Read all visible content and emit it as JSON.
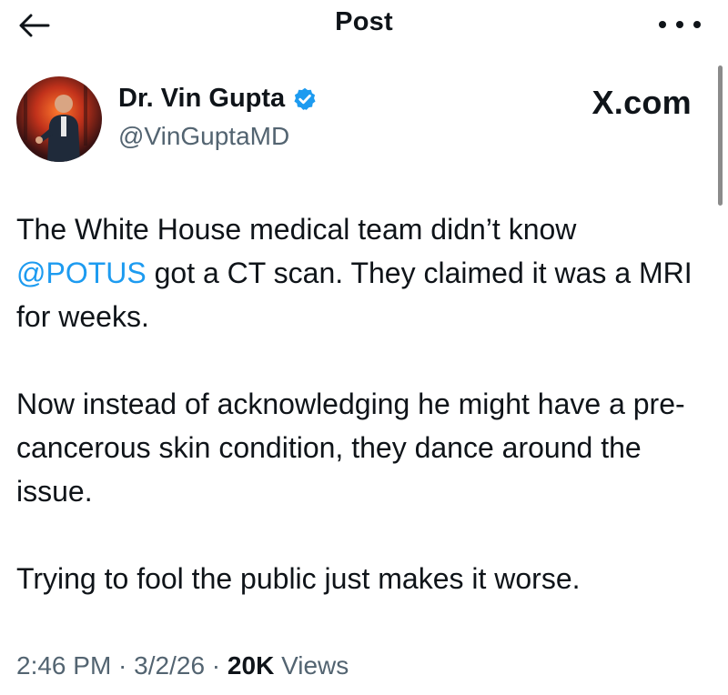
{
  "header": {
    "title": "Post",
    "back_icon": "arrow-left-icon",
    "more_icon": "more-horizontal-icon"
  },
  "author": {
    "name": "Dr. Vin Gupta",
    "handle": "@VinGuptaMD",
    "verified_color": "#1d9bf0",
    "source": "X.com"
  },
  "post": {
    "line1_prefix": "The White House medical team didn’t know",
    "mention": "@POTUS",
    "line2_suffix": " got a CT scan. They claimed it was a MRI for weeks.",
    "paragraph2": "Now instead of acknowledging he might have a pre-cancerous skin condition, they dance around the issue.",
    "paragraph3": "Trying to fool the public just makes it worse."
  },
  "meta": {
    "time": "2:46 PM",
    "sep1": " · ",
    "date": "3/2/26",
    "sep2": " · ",
    "views_count": "20K",
    "views_label": " Views"
  },
  "colors": {
    "accent": "#1d9bf0",
    "text": "#0f1419",
    "secondary": "#536471"
  }
}
